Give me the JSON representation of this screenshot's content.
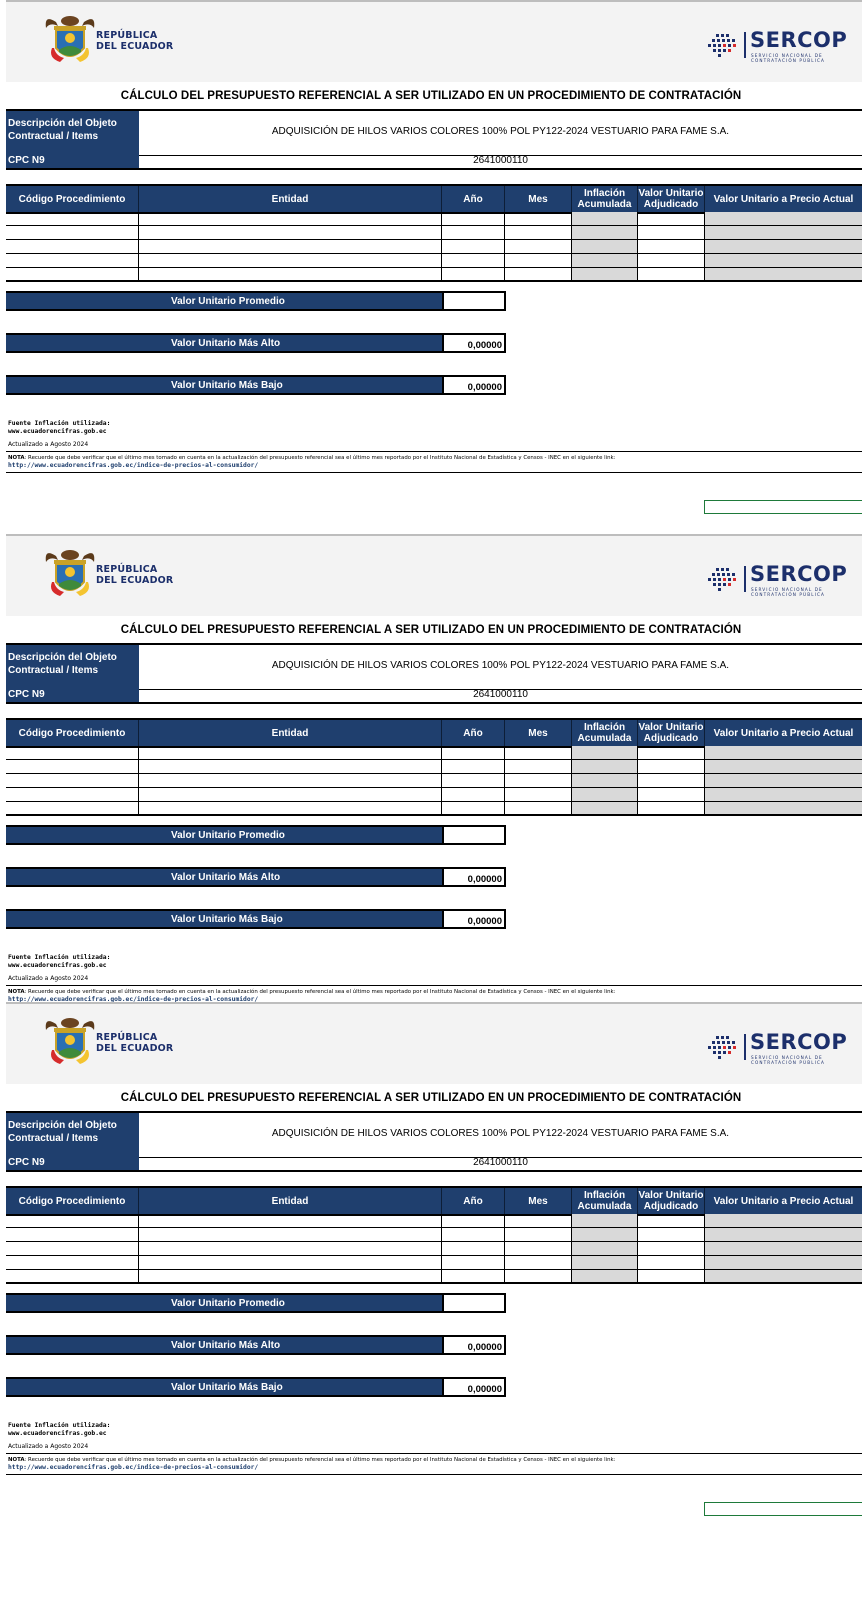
{
  "header": {
    "ecuador_line1": "REPÚBLICA",
    "ecuador_line2": "DEL ECUADOR",
    "sercop_word": "SERCOP",
    "sercop_sub_line1": "SERVICIO NACIONAL DE",
    "sercop_sub_line2": "CONTRATACIÓN PÚBLICA"
  },
  "form": {
    "title": "CÁLCULO DEL PRESUPUESTO REFERENCIAL A SER UTILIZADO EN UN PROCEDIMIENTO DE CONTRATACIÓN",
    "desc_label": "Descripción del Objeto Contractual / Items",
    "desc_value": "ADQUISICIÓN DE HILOS VARIOS COLORES 100% POL PY122-2024 VESTUARIO PARA FAME S.A.",
    "cpc_label": "CPC N9",
    "cpc_value": "2641000110",
    "columns": [
      "Código Procedimiento",
      "Entidad",
      "Año",
      "Mes",
      "Inflación Acumulada",
      "Valor Unitario Adjudicado",
      "Valor Unitario a Precio Actual"
    ],
    "summary": {
      "promedio_label": "Valor Unitario Promedio",
      "promedio_value": "",
      "alto_label": "Valor Unitario Más Alto",
      "alto_value": "0,00000",
      "bajo_label": "Valor Unitario Más Bajo",
      "bajo_value": "0,00000"
    },
    "notes": {
      "fuente_label": "Fuente Inflación utilizada:",
      "fuente_url": "www.ecuadorencifras.gob.ec",
      "actualizado": "Actualizado a Agosto 2024",
      "nota_label": "NOTA",
      "nota_text": ": Recuerde que debe verificar que el último mes tomado en cuenta en la actualización del presupuesto referencial sea el último mes reportado por el Instituto Nacional de Estadística y Censos - INEC en el siguiente link:",
      "nota_link": "http://www.ecuadorencifras.gob.ec/indice-de-precios-al-consumidor/"
    }
  },
  "colors": {
    "navy": "#1f3f6e",
    "grey_cell": "#d9d9d9",
    "green_outline": "#1e7a3a"
  },
  "icons": [
    "ecuador-coat-of-arms-icon",
    "sercop-logo-dots-icon"
  ]
}
